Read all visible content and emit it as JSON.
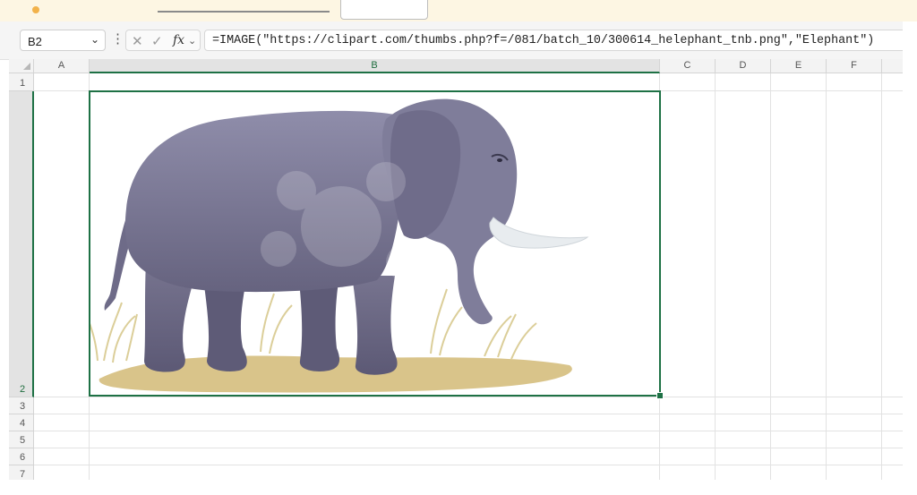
{
  "banner": {
    "icons": [
      "alert-dot-icon"
    ]
  },
  "formula_bar": {
    "name_box": "B2",
    "cancel_icon": "cancel-icon",
    "enter_icon": "check-icon",
    "fx_label": "fx",
    "formula": "=IMAGE(\"https://clipart.com/thumbs.php?f=/081/batch_10/300614_helephant_tnb.png\",\"Elephant\")"
  },
  "sheet": {
    "columns": [
      "A",
      "B",
      "C",
      "D",
      "E",
      "F"
    ],
    "rows": [
      "1",
      "2",
      "3",
      "4",
      "5",
      "6",
      "7"
    ],
    "selected_cell": "B2",
    "cell_image": {
      "alt_text": "Elephant",
      "icon": "elephant-image"
    }
  },
  "colors": {
    "selection": "#1e7145",
    "header_bg": "#f3f3f3",
    "elephant_body": "#7a7894",
    "ground": "#d9c48a",
    "tusk": "#e8ecef"
  }
}
